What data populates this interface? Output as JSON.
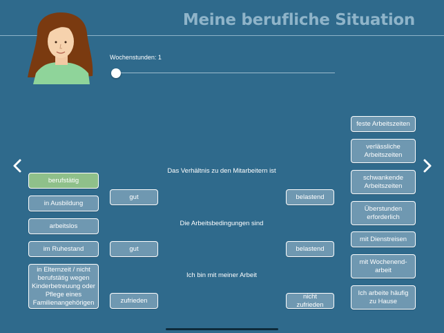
{
  "title": "Meine berufliche Situation",
  "hours": {
    "label": "Wochenstunden: 1",
    "value": 1
  },
  "nav": {
    "prev_icon": "chevron-left-icon",
    "next_icon": "chevron-right-icon"
  },
  "status_options": [
    {
      "label": "berufstätig",
      "selected": true
    },
    {
      "label": "in Ausbildung",
      "selected": false
    },
    {
      "label": "arbeitslos",
      "selected": false
    },
    {
      "label": "im Ruhestand",
      "selected": false
    },
    {
      "label": "in Elternzeit / nicht berufstätig wegen Kinderbetreuung oder Pflege eines Familienangehörigen",
      "selected": false
    }
  ],
  "ratings": [
    {
      "question": "Das Verhältnis zu den Mitarbeitern ist",
      "left": "gut",
      "right": "belastend"
    },
    {
      "question": "Die Arbeitsbedingungen sind",
      "left": "gut",
      "right": "belastend"
    },
    {
      "question": "Ich bin mit meiner Arbeit",
      "left": "zufrieden",
      "right": "nicht zufrieden"
    }
  ],
  "work_conditions": [
    "feste Arbeitszeiten",
    "verlässliche Arbeitszeiten",
    "schwankende Arbeitszeiten",
    "Überstunden erforderlich",
    "mit Dienstreisen",
    "mit Wochenend-arbeit",
    "Ich arbeite häufig zu Hause"
  ],
  "colors": {
    "background": "#2f6a8c",
    "button": "#6f98b1",
    "selected": "#8fc08a",
    "title": "#8fb4c9"
  }
}
